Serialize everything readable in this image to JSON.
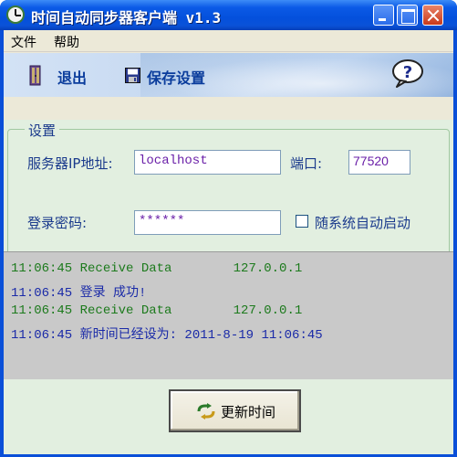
{
  "window": {
    "title": "时间自动同步器客户端 v1.3"
  },
  "menu": {
    "file": "文件",
    "help": "帮助"
  },
  "toolbar": {
    "exit_label": "退出",
    "save_label": "保存设置"
  },
  "settings": {
    "group_title": "设置",
    "server_ip_label": "服务器IP地址:",
    "server_ip_value": "localhost",
    "port_label": "端口:",
    "port_value": "77520",
    "password_label": "登录密码:",
    "password_value": "******",
    "auto_start_label": "随系统自动启动",
    "auto_start_checked": false
  },
  "log": [
    {
      "time": "11:06:45",
      "text": "Receive Data        127.0.0.1",
      "color": "#1c7a1c"
    },
    {
      "time": "11:06:45",
      "text": "登录 成功!",
      "color": "#1a2aa8"
    },
    {
      "time": "11:06:45",
      "text": "Receive Data        127.0.0.1",
      "color": "#1c7a1c"
    },
    {
      "time": "11:06:45",
      "text": "新时间已经设为: 2011-8-19 11:06:45",
      "color": "#1a2aa8"
    }
  ],
  "update_button": {
    "label": "更新时间"
  },
  "icons": {
    "app": "clock-icon",
    "exit": "door-exit-icon",
    "save": "floppy-disk-icon",
    "help": "help-bubble-icon",
    "update": "sync-icon"
  },
  "colors": {
    "titlebar": "#0450dc",
    "label_text": "#1a3a8c",
    "field_text": "#6a1fa8",
    "log_green": "#1c7a1c",
    "log_blue": "#1a2aa8",
    "panel_bg": "#e2efe0",
    "log_bg": "#c9c9c9"
  }
}
